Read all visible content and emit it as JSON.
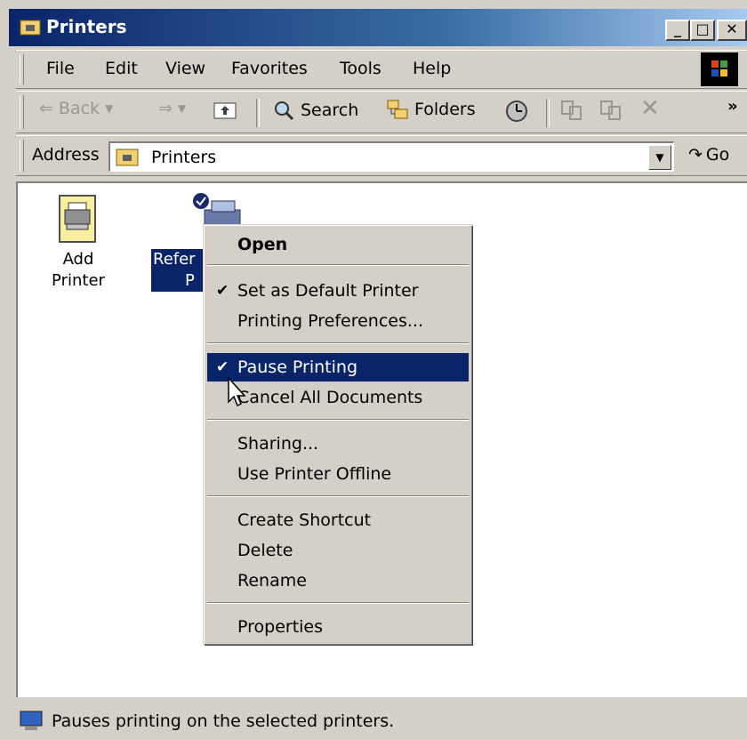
{
  "window": {
    "title": "Printers"
  },
  "menubar": {
    "items": [
      {
        "label": "File"
      },
      {
        "label": "Edit"
      },
      {
        "label": "View"
      },
      {
        "label": "Favorites"
      },
      {
        "label": "Tools"
      },
      {
        "label": "Help"
      }
    ]
  },
  "toolbar": {
    "back_label": "Back",
    "search_label": "Search",
    "folders_label": "Folders",
    "chevron": "»"
  },
  "address": {
    "label": "Address",
    "value": "Printers",
    "go_label": "Go"
  },
  "content": {
    "items": [
      {
        "label": "Add Printer"
      },
      {
        "label_line1": "Refer",
        "label_line2": "P"
      }
    ]
  },
  "context_menu": {
    "items": [
      {
        "label": "Open",
        "bold": true
      },
      {
        "label": "Set as Default Printer",
        "checked": true
      },
      {
        "label": "Printing Preferences..."
      },
      {
        "label": "Pause Printing",
        "checked": true,
        "highlighted": true
      },
      {
        "label": "Cancel All Documents"
      },
      {
        "label": "Sharing..."
      },
      {
        "label": "Use Printer Offline"
      },
      {
        "label": "Create Shortcut"
      },
      {
        "label": "Delete"
      },
      {
        "label": "Rename"
      },
      {
        "label": "Properties"
      }
    ]
  },
  "statusbar": {
    "text": "Pauses printing on the selected printers."
  },
  "colors": {
    "title_bar": "#0a246a",
    "highlight": "#0a246a",
    "chrome": "#d4d0c8"
  }
}
